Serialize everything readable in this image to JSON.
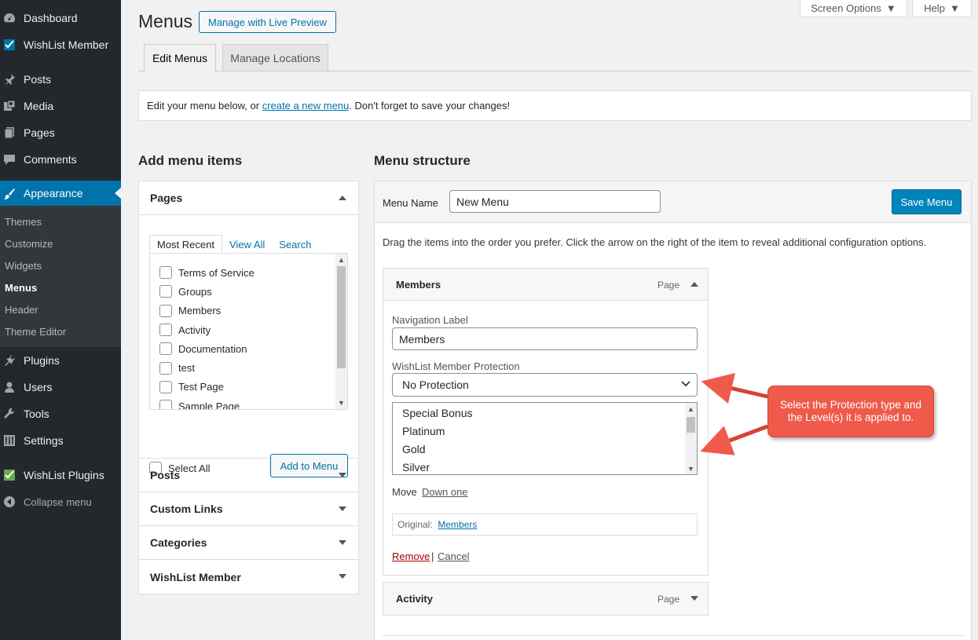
{
  "sidebar": {
    "top_items": [
      {
        "label": "Dashboard",
        "icon": "dashboard-icon"
      },
      {
        "label": "WishList Member",
        "icon": "wishlist-check-icon"
      }
    ],
    "items": [
      {
        "label": "Posts",
        "icon": "pushpin-icon"
      },
      {
        "label": "Media",
        "icon": "media-icon"
      },
      {
        "label": "Pages",
        "icon": "pages-icon"
      },
      {
        "label": "Comments",
        "icon": "comment-icon"
      }
    ],
    "appearance": {
      "label": "Appearance",
      "icon": "brush-icon"
    },
    "appearance_sub": [
      "Themes",
      "Customize",
      "Widgets",
      "Menus",
      "Header",
      "Theme Editor"
    ],
    "current_sub": "Menus",
    "lower_items": [
      {
        "label": "Plugins",
        "icon": "plugin-icon"
      },
      {
        "label": "Users",
        "icon": "user-icon"
      },
      {
        "label": "Tools",
        "icon": "wrench-icon"
      },
      {
        "label": "Settings",
        "icon": "settings-icon"
      }
    ],
    "wl_plugins": {
      "label": "WishList Plugins",
      "icon": "wishlist-check-icon"
    },
    "collapse": {
      "label": "Collapse menu",
      "icon": "collapse-icon"
    }
  },
  "header": {
    "title": "Menus",
    "live_preview": "Manage with Live Preview",
    "screen_options": "Screen Options",
    "help": "Help",
    "tabs": [
      "Edit Menus",
      "Manage Locations"
    ]
  },
  "notice": {
    "before": "Edit your menu below, or ",
    "link": "create a new menu",
    "after": ". Don't forget to save your changes!"
  },
  "add_items": {
    "title": "Add menu items",
    "pages_panel": {
      "title": "Pages",
      "tabs": [
        "Most Recent",
        "View All",
        "Search"
      ],
      "pages": [
        "Terms of Service",
        "Groups",
        "Members",
        "Activity",
        "Documentation",
        "test",
        "Test Page",
        "Sample Page"
      ],
      "select_all": "Select All",
      "add_button": "Add to Menu"
    },
    "other_panels": [
      "Posts",
      "Custom Links",
      "Categories",
      "WishList Member"
    ]
  },
  "structure": {
    "title": "Menu structure",
    "menu_name_label": "Menu Name",
    "menu_name_value": "New Menu",
    "save_button": "Save Menu",
    "instructions": "Drag the items into the order you prefer. Click the arrow on the right of the item to reveal additional configuration options.",
    "item_open": {
      "title": "Members",
      "type": "Page",
      "nav_label_label": "Navigation Label",
      "nav_label_value": "Members",
      "protection_label": "WishList Member Protection",
      "protection_value": "No Protection",
      "levels": [
        "Special Bonus",
        "Platinum",
        "Gold",
        "Silver"
      ],
      "move_label": "Move",
      "move_link": "Down one",
      "original_label": "Original:",
      "original_link": "Members",
      "remove": "Remove",
      "separator": "|",
      "cancel": "Cancel"
    },
    "item_closed": {
      "title": "Activity",
      "type": "Page"
    }
  },
  "annotation": {
    "text": "Select the Protection type and the Level(s) it is applied to.",
    "color": "#f05a4a"
  },
  "colors": {
    "sidebar_bg": "#23282d",
    "accent": "#0073aa",
    "primary_button": "#0085ba"
  }
}
